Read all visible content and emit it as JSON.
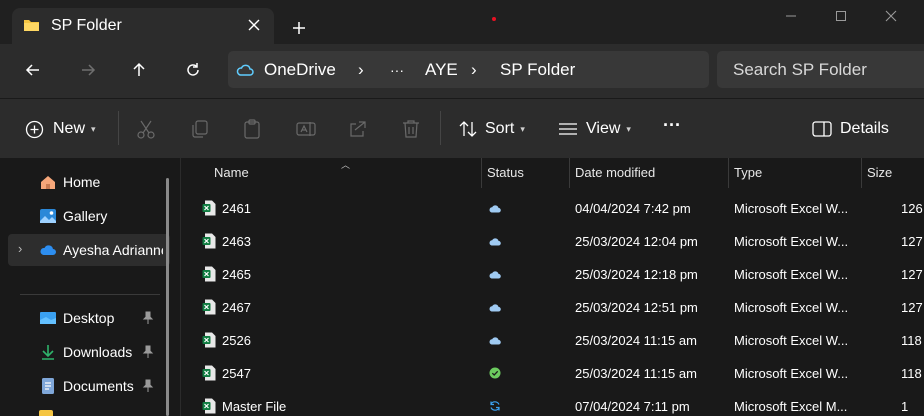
{
  "tab": {
    "title": "SP Folder"
  },
  "breadcrumb": {
    "root": "OneDrive",
    "ellipsis": "···",
    "parts": [
      "AYE",
      "SP Folder"
    ]
  },
  "search": {
    "placeholder": "Search SP Folder"
  },
  "commands": {
    "new_label": "New",
    "sort_label": "Sort",
    "view_label": "View",
    "more_label": "···",
    "details_label": "Details"
  },
  "nav": {
    "items": [
      {
        "label": "Home",
        "icon": "home-icon"
      },
      {
        "label": "Gallery",
        "icon": "gallery-icon"
      },
      {
        "label": "Ayesha Adrianne",
        "icon": "onedrive-cloud-icon"
      },
      {
        "label": "Desktop",
        "icon": "desktop-icon",
        "pinned": true
      },
      {
        "label": "Downloads",
        "icon": "download-icon",
        "pinned": true
      },
      {
        "label": "Documents",
        "icon": "documents-icon",
        "pinned": true
      }
    ]
  },
  "columns": {
    "name": "Name",
    "status": "Status",
    "date": "Date modified",
    "type": "Type",
    "size": "Size"
  },
  "files": [
    {
      "name": "2461",
      "status": "cloud",
      "date": "04/04/2024 7:42 pm",
      "type": "Microsoft Excel W...",
      "size": "126"
    },
    {
      "name": "2463",
      "status": "cloud",
      "date": "25/03/2024 12:04 pm",
      "type": "Microsoft Excel W...",
      "size": "127"
    },
    {
      "name": "2465",
      "status": "cloud",
      "date": "25/03/2024 12:18 pm",
      "type": "Microsoft Excel W...",
      "size": "127"
    },
    {
      "name": "2467",
      "status": "cloud",
      "date": "25/03/2024 12:51 pm",
      "type": "Microsoft Excel W...",
      "size": "127"
    },
    {
      "name": "2526",
      "status": "cloud",
      "date": "25/03/2024 11:15 am",
      "type": "Microsoft Excel W...",
      "size": "118"
    },
    {
      "name": "2547",
      "status": "available",
      "date": "25/03/2024 11:15 am",
      "type": "Microsoft Excel W...",
      "size": "118"
    },
    {
      "name": "Master File",
      "status": "syncing",
      "date": "07/04/2024 7:11 pm",
      "type": "Microsoft Excel M...",
      "size": "1"
    }
  ],
  "colors": {
    "accent": "#60cdff",
    "excel": "#107c41",
    "ok": "#6ccb5f"
  }
}
